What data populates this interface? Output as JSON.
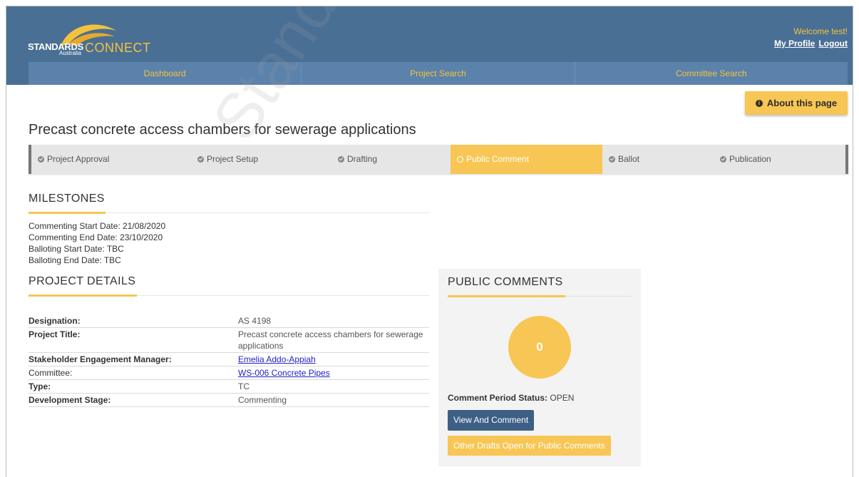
{
  "header": {
    "logo": {
      "line1": "STANDARDS",
      "line2": "Australia",
      "line3": "CONNECT"
    },
    "welcome": "Welcome test!",
    "profile_link": "My Profile",
    "logout_link": "Logout"
  },
  "nav": [
    "Dashboard",
    "Project Search",
    "Committee Search"
  ],
  "about_button": "About this page",
  "page_title": "Precast concrete access chambers for sewerage applications",
  "stages": [
    {
      "label": "Project Approval",
      "state": "done"
    },
    {
      "label": "Project Setup",
      "state": "done"
    },
    {
      "label": "Drafting",
      "state": "done"
    },
    {
      "label": "Public Comment",
      "state": "active"
    },
    {
      "label": "Ballot",
      "state": "done"
    },
    {
      "label": "Publication",
      "state": "done"
    }
  ],
  "milestones": {
    "title": "MILESTONES",
    "items": [
      "Commenting Start Date: 21/08/2020",
      "Commenting End Date: 23/10/2020",
      "Balloting Start Date: TBC",
      "Balloting End Date: TBC"
    ]
  },
  "project_details": {
    "title": "PROJECT DETAILS",
    "rows": [
      {
        "label": "Designation:",
        "value": "AS 4198"
      },
      {
        "label": "Project Title:",
        "value": "Precast concrete access chambers for sewerage applications"
      },
      {
        "label": "Stakeholder Engagement Manager:",
        "value": "Emelia Addo-Appiah"
      },
      {
        "label": "Committee:",
        "value": "WS-006 Concrete Pipes"
      },
      {
        "label": "Type:",
        "value": "TC"
      },
      {
        "label": "Development Stage:",
        "value": "Commenting"
      }
    ]
  },
  "public_comments": {
    "title": "PUBLIC COMMENTS",
    "count": "0",
    "status_label": "Comment Period Status:",
    "status_value": "OPEN",
    "view_button": "View And Comment",
    "drafts_button": "Other Drafts Open for Public Comments"
  },
  "watermark": "Standards",
  "colors": {
    "header": "#4a6f95",
    "nav": "#5b82ab",
    "accent": "#f7c654",
    "primary_button": "#3d5f86"
  }
}
